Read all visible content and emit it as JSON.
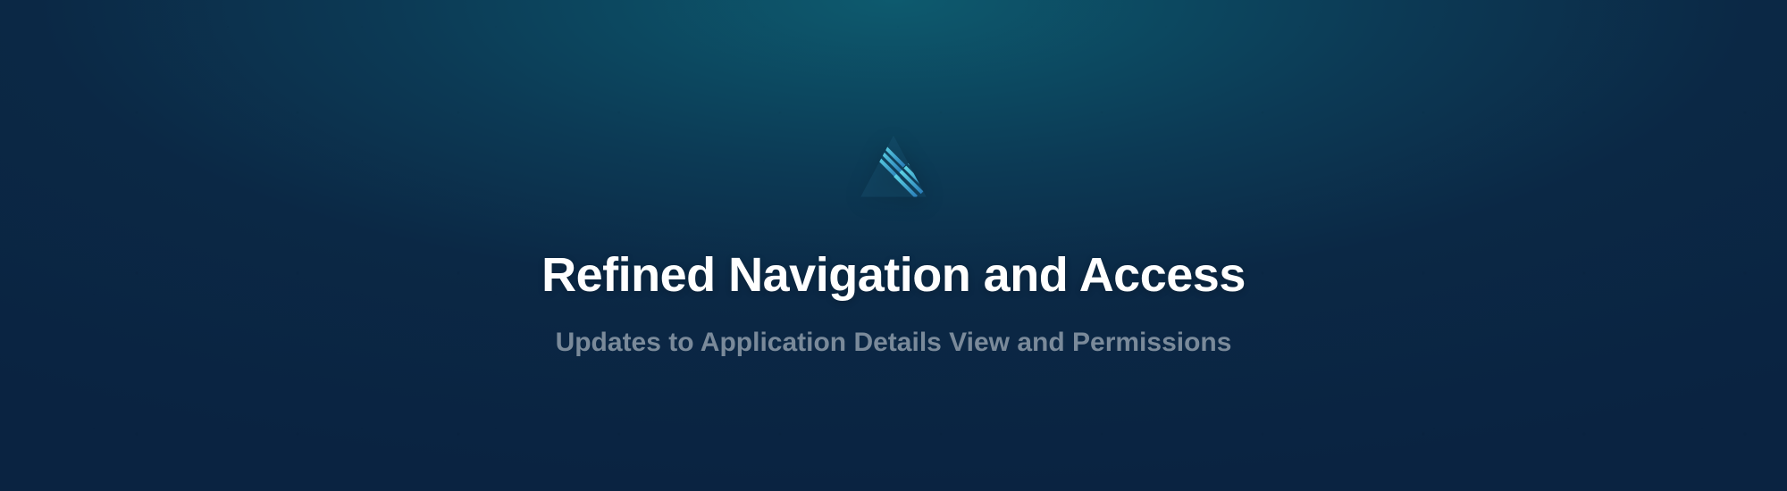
{
  "banner": {
    "title": "Refined Navigation and Access",
    "subtitle": "Updates to Application Details View and Permissions"
  },
  "logo": {
    "name": "triangle-stripe-logo",
    "colors": {
      "light": "#4dc4d4",
      "dark": "#2a7eb8"
    }
  }
}
